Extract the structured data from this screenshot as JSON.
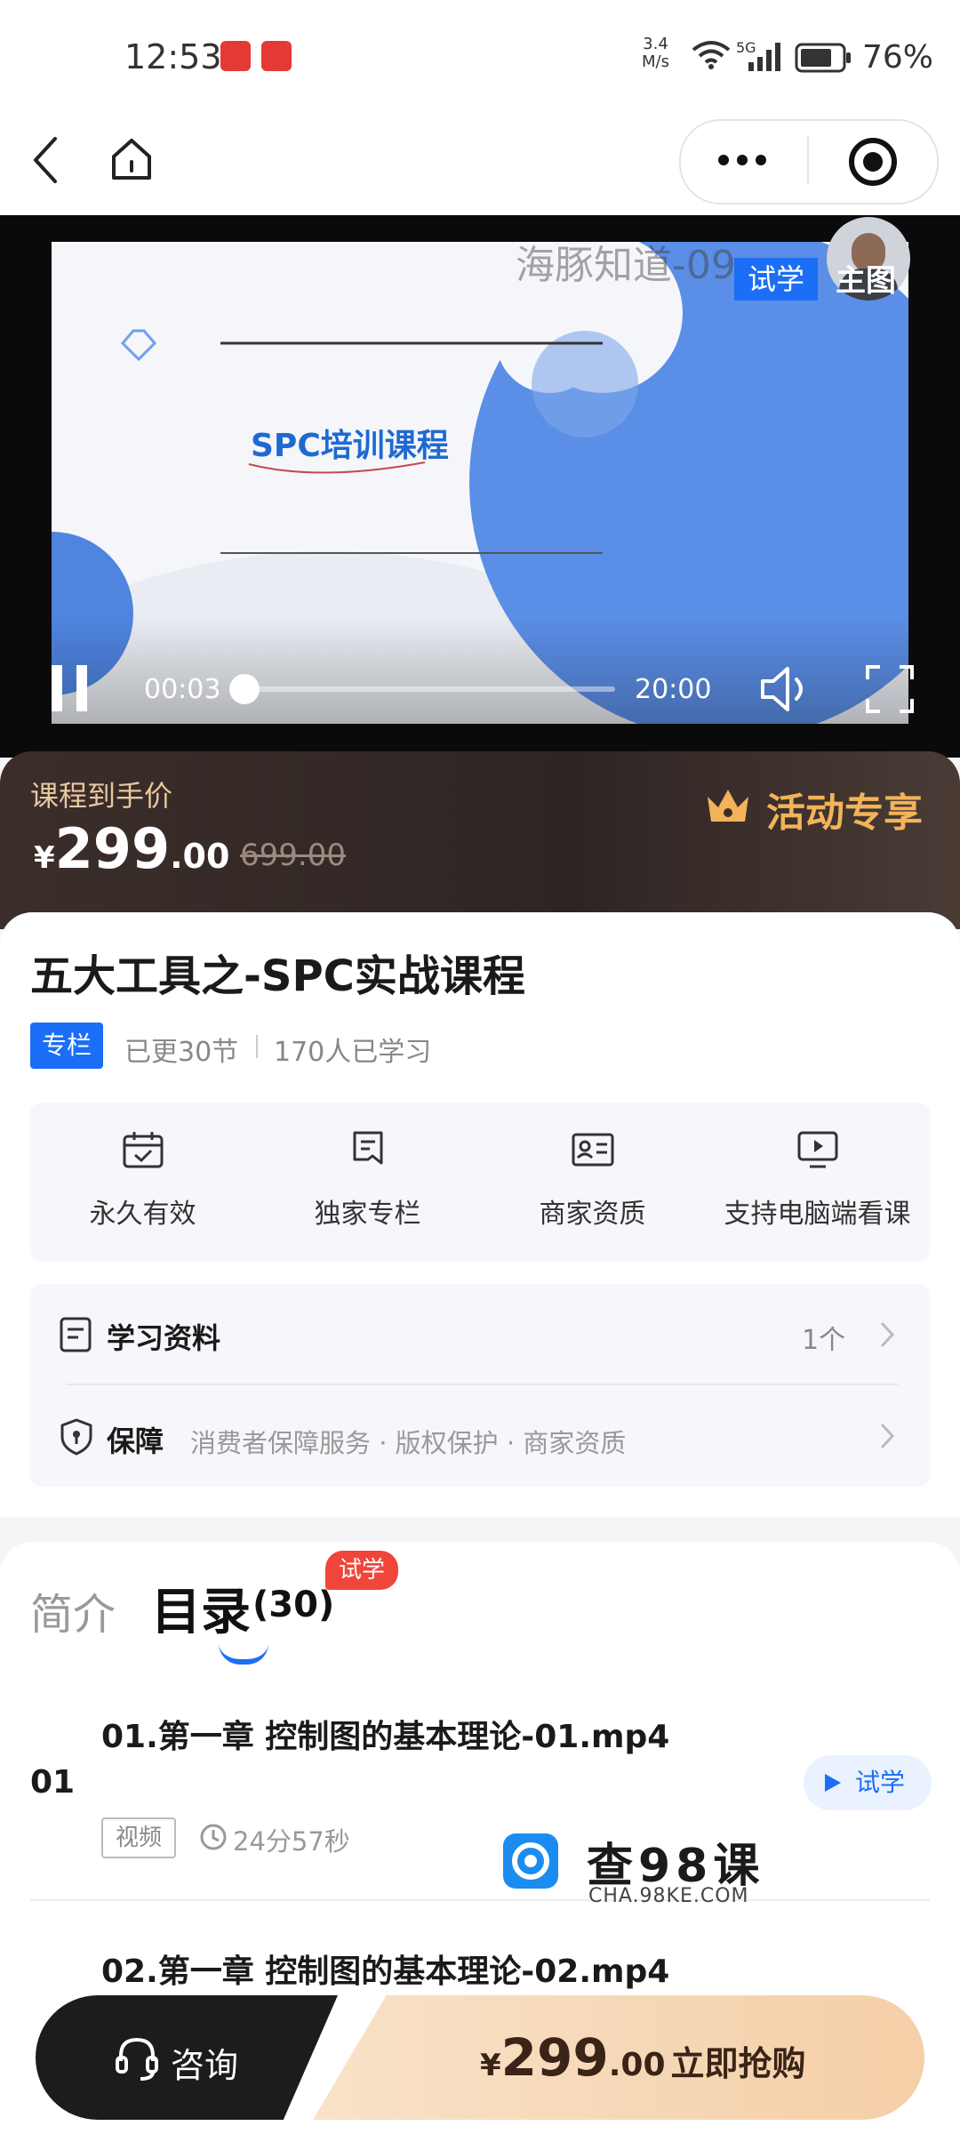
{
  "status_bar": {
    "time": "12:53",
    "net_speed_value": "3.4",
    "net_speed_unit": "M/s",
    "signal_label": "5G",
    "battery_percent": "76%"
  },
  "nav": {
    "back_icon": "chevron-left-icon",
    "home_icon": "home-icon",
    "more_icon": "more-dots-icon",
    "target_icon": "record-target-icon"
  },
  "video": {
    "watermark": "海豚知道-09",
    "trial_badge": "试学",
    "instructor_label": "主图",
    "slide_title": "SPC培训课程",
    "current_time": "00:03",
    "total_time": "20:00",
    "progress": 0.0025
  },
  "price": {
    "label": "课程到手价",
    "currency": "¥",
    "integer": "299",
    "decimal": ".00",
    "original": "699.00",
    "promo": "活动专享"
  },
  "course": {
    "title": "五大工具之-SPC实战课程",
    "tag": "专栏",
    "updated": "已更30节",
    "learners": "170人已学习",
    "features": [
      {
        "label": "永久有效",
        "icon": "calendar-check-icon"
      },
      {
        "label": "独家专栏",
        "icon": "bookmark-icon"
      },
      {
        "label": "商家资质",
        "icon": "id-card-icon"
      },
      {
        "label": "支持电脑端看课",
        "icon": "monitor-play-icon"
      }
    ],
    "materials_label": "学习资料",
    "materials_count": "1个",
    "guarantee_label": "保障",
    "guarantee_items": "消费者保障服务 · 版权保护 · 商家资质"
  },
  "catalog": {
    "tab_intro": "简介",
    "tab_catalog": "目录",
    "count": "(30)",
    "trial_badge": "试学",
    "lessons": [
      {
        "num": "01",
        "title": "01.第一章 控制图的基本理论-01.mp4",
        "type": "视频",
        "duration": "24分57秒",
        "trial": "试学"
      },
      {
        "title": "02.第一章 控制图的基本理论-02.mp4"
      }
    ]
  },
  "watermark": {
    "text": "查98课",
    "sub": "CHA.98KE.COM"
  },
  "bottom": {
    "consult": "咨询",
    "currency": "¥",
    "price_int": "299",
    "price_dec": ".00",
    "buy_label": "立即抢购"
  },
  "colors": {
    "accent_blue": "#1b6ef5",
    "badge_red": "#f0453a",
    "promo_gold": "#f2b35a"
  }
}
